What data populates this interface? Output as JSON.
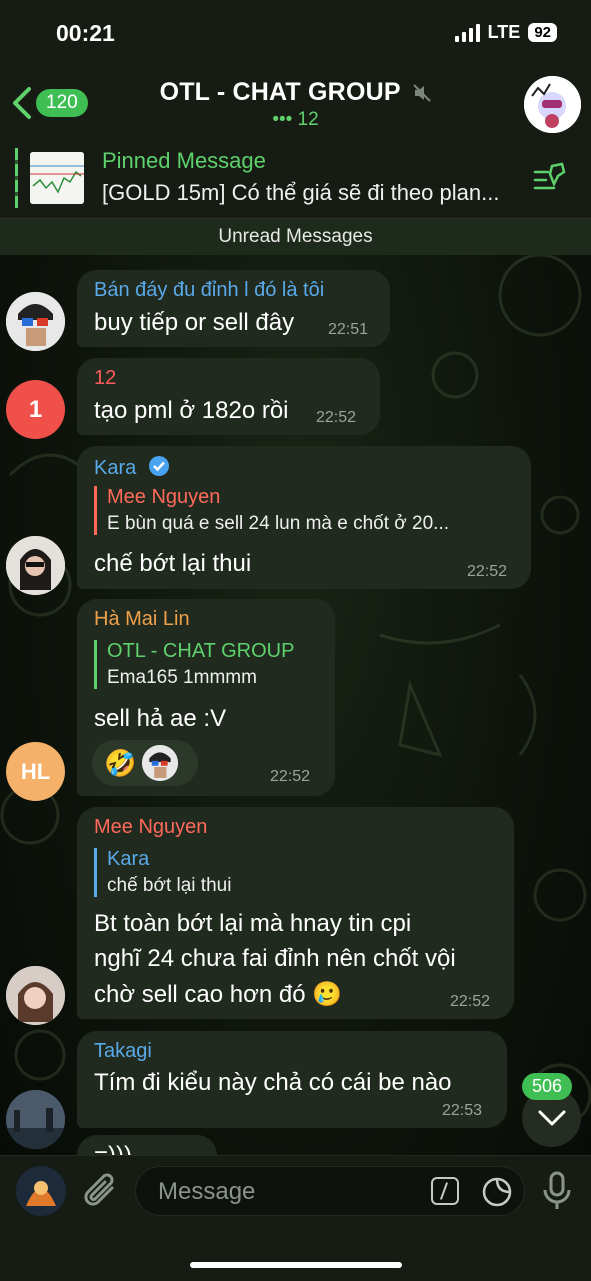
{
  "status": {
    "time": "00:21",
    "network": "LTE",
    "battery": "92"
  },
  "header": {
    "back_count": "120",
    "title": "OTL - CHAT GROUP",
    "subtitle": "••• 12"
  },
  "pinned": {
    "label": "Pinned Message",
    "text": "[GOLD 15m] Có thể giá sẽ đi theo plan..."
  },
  "unread_label": "Unread Messages",
  "messages": [
    {
      "sender": "Bán đáy đu đỉnh l đó là tôi",
      "text": "buy tiếp or sell đây",
      "time": "22:51",
      "color": "#5aa9e8"
    },
    {
      "sender": "12",
      "text": "tạo pml ở 182o rồi",
      "time": "22:52",
      "color": "#ff5b5b",
      "avatar_text": "1"
    },
    {
      "sender": "Kara",
      "reply_name": "Mee Nguyen",
      "reply_text": "E bùn quá e sell 24 lun mà e chốt ở 20...",
      "text": "chế bớt lại thui",
      "time": "22:52",
      "color": "#5aa9e8"
    },
    {
      "sender": "Hà Mai Lin",
      "reply_name": "OTL - CHAT GROUP",
      "reply_text": "Ema165 1mmmm",
      "text": "sell hả ae :V",
      "time": "22:52",
      "color": "#f0a04b",
      "avatar_text": "HL"
    },
    {
      "sender": "Mee Nguyen",
      "reply_name": "Kara",
      "reply_text": "chế bớt lại thui",
      "text_lines": [
        "Bt toàn bớt lại mà hnay tin cpi",
        "nghĩ 24 chưa fai đỉnh nên chốt vội",
        "chờ sell cao hơn đó 🥲"
      ],
      "time": "22:52",
      "color": "#ff6a5b"
    },
    {
      "sender": "Takagi",
      "text": "Tím đi kiểu này chả có cái be nào",
      "time": "22:53",
      "color": "#5aa9e8"
    },
    {
      "text": "=)))"
    }
  ],
  "reaction": {
    "emoji": "🤣"
  },
  "scroll": {
    "unread_count": "506"
  },
  "composer": {
    "placeholder": "Message"
  }
}
